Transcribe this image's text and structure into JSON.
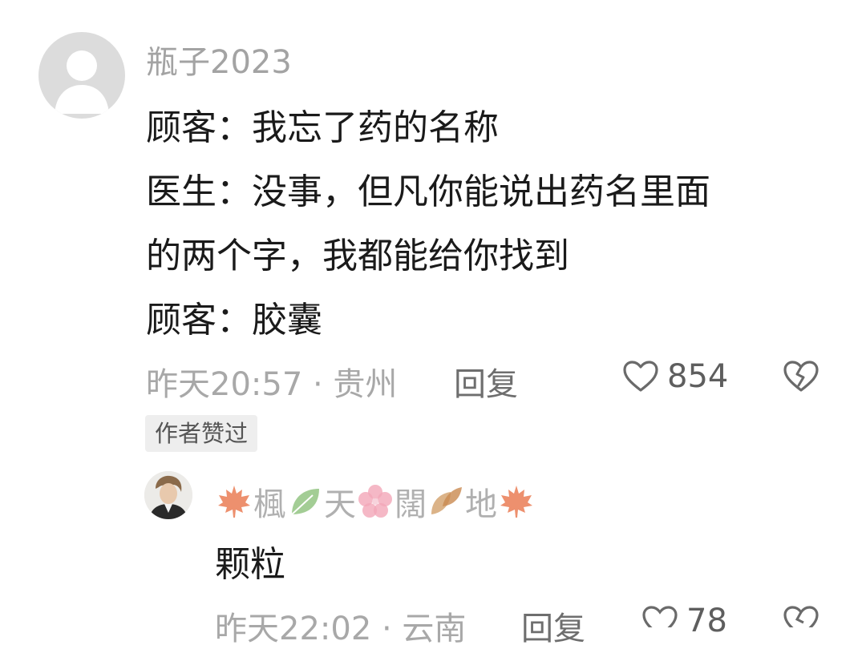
{
  "comment": {
    "username": "瓶子2023",
    "lines": [
      "顾客：我忘了药的名称",
      "医生：没事，但凡你能说出药名里面",
      "的两个字，我都能给你找到",
      "顾客：胶囊"
    ],
    "time_location": "昨天20:57 · 贵州",
    "reply_label": "回复",
    "like_count": "854",
    "author_badge": "作者赞过"
  },
  "reply": {
    "name_chars": [
      "楓",
      "天",
      "闊",
      "地"
    ],
    "text": "颗粒",
    "time_location": "昨天22:02 · 云南",
    "reply_label": "回复",
    "like_count": "78"
  },
  "icons": {
    "like": "heart-outline-icon",
    "dislike": "broken-heart-icon",
    "name_decorations": [
      "maple-leaf-icon",
      "green-leaf-icon",
      "cherry-blossom-icon",
      "autumn-leaves-icon",
      "maple-leaf-icon"
    ]
  },
  "colors": {
    "maple": "#e8744a",
    "leaf": "#8cc07a",
    "blossom": "#f2a6b8",
    "autumn": "#d2a06a"
  }
}
